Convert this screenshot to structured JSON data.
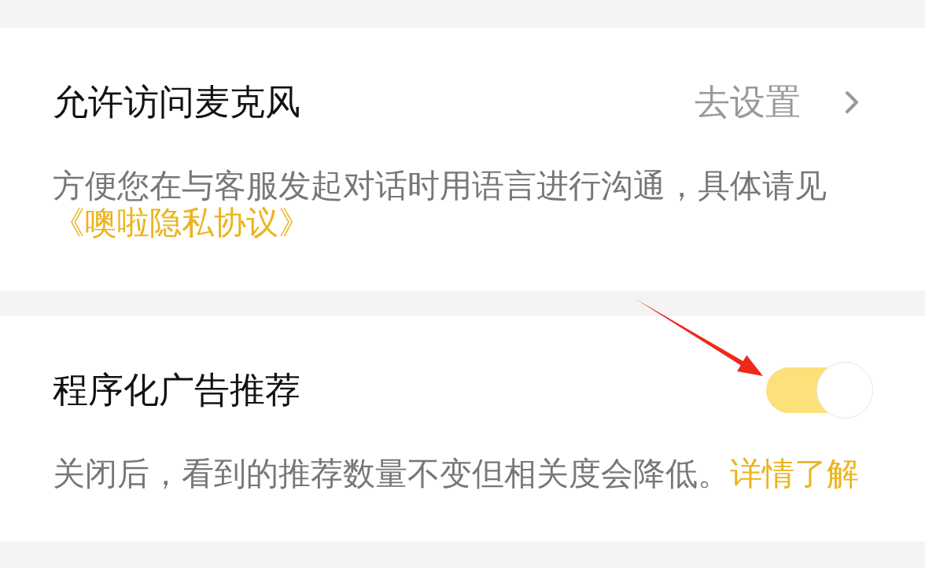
{
  "sections": [
    {
      "kind": "link",
      "title": "允许访问麦克风",
      "action": "去设置",
      "description": "方便您在与客服发起对话时用语言进行沟通，具体请见",
      "link": "《噢啦隐私协议》"
    },
    {
      "kind": "toggle",
      "title": "程序化广告推荐",
      "on": true,
      "description": "关闭后，看到的推荐数量不变但相关度会降低。",
      "link": "详情了解"
    }
  ]
}
